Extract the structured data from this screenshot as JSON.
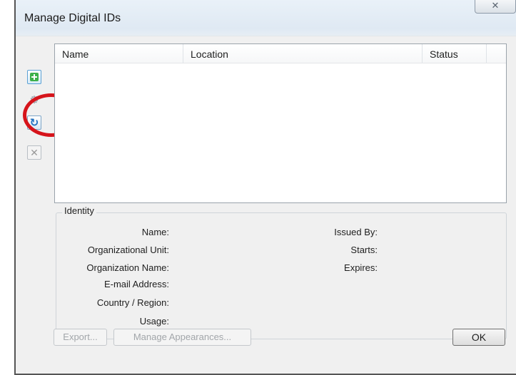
{
  "window": {
    "title": "Manage Digital IDs",
    "close_glyph": "✕"
  },
  "toolbar": {
    "add_icon": "plus-icon",
    "settings_icon": "gear-icon",
    "settings_glyph": "⚙",
    "refresh_icon": "refresh-icon",
    "refresh_glyph": "↻",
    "remove_icon": "close-icon",
    "remove_glyph": "✕"
  },
  "list": {
    "columns": [
      "Name",
      "Location",
      "Status"
    ],
    "rows": []
  },
  "identity": {
    "group_label": "Identity",
    "left_fields": [
      "Name:",
      "Organizational Unit:",
      "Organization Name:",
      "E-mail Address:",
      "Country / Region:",
      "Usage:"
    ],
    "right_fields": [
      "Issued By:",
      "Starts:",
      "Expires:"
    ]
  },
  "buttons": {
    "export": "Export...",
    "manage_appearances": "Manage Appearances...",
    "ok": "OK"
  },
  "colors": {
    "highlight": "#d6141b",
    "add_icon": "#3db04a",
    "refresh_icon": "#1f6fc0"
  }
}
